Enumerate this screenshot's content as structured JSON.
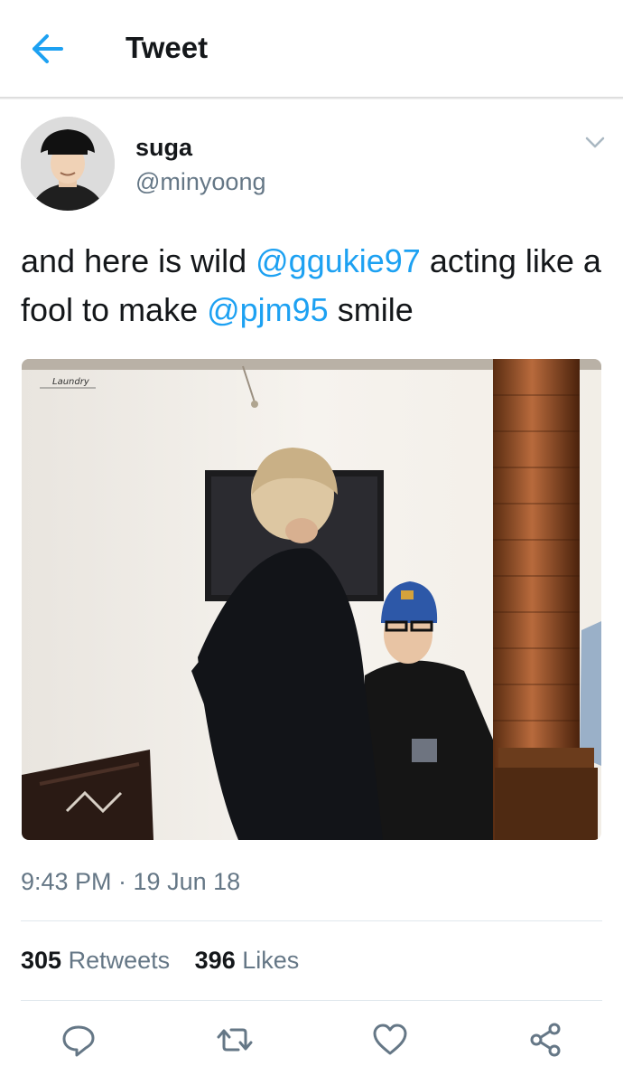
{
  "header": {
    "title": "Tweet",
    "back_icon": "back-arrow-icon"
  },
  "tweet": {
    "author": {
      "name": "suga",
      "handle": "@minyoong"
    },
    "text": {
      "part1": "and here is wild ",
      "mention1": "@ggukie97",
      "part2": " acting like a fool to make ",
      "mention2": "@pjm95",
      "part3": " smile"
    },
    "media_watermark": "Laundry",
    "timestamp": "9:43 PM · 19 Jun 18",
    "stats": {
      "retweets_count": "305",
      "retweets_label": "Retweets",
      "likes_count": "396",
      "likes_label": "Likes"
    }
  },
  "actions": [
    "reply-icon",
    "retweet-icon",
    "like-icon",
    "share-icon"
  ],
  "colors": {
    "accent": "#1da1f2",
    "text": "#14171a",
    "secondary": "#657786",
    "border": "#e1e8ed"
  }
}
